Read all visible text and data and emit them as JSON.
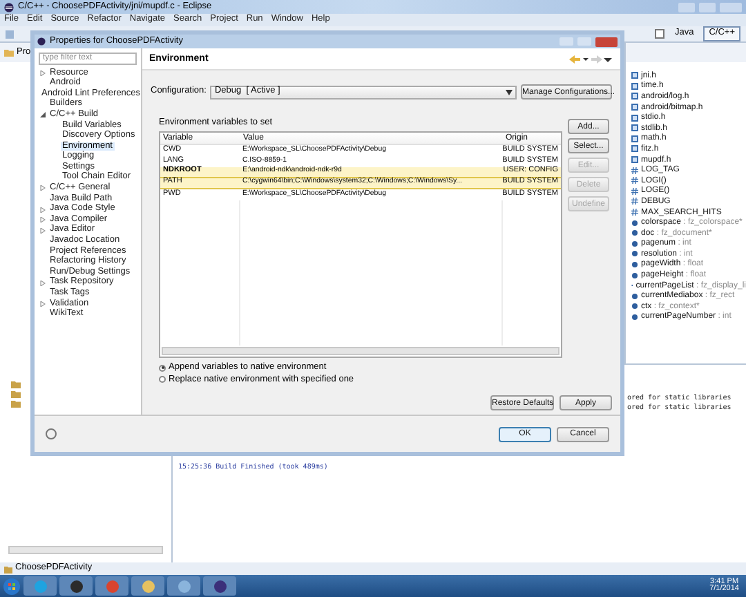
{
  "window": {
    "title": "C/C++ - ChoosePDFActivity/jni/mupdf.c - Eclipse",
    "menu": [
      "File",
      "Edit",
      "Source",
      "Refactor",
      "Navigate",
      "Search",
      "Project",
      "Run",
      "Window",
      "Help"
    ]
  },
  "toolbar": {
    "perspectives": [
      {
        "label": "Java",
        "selected": false
      },
      {
        "label": "C/C++",
        "selected": true
      }
    ]
  },
  "project_explorer": {
    "tab": "Pro"
  },
  "dialog": {
    "title": "Properties for ChoosePDFActivity",
    "filter": {
      "placeholder": "type filter text"
    },
    "tree": [
      {
        "label": "Resource",
        "expanded": false,
        "selected": false
      },
      {
        "label": "Android",
        "selected": false
      },
      {
        "label": "Android Lint Preferences",
        "selected": false
      },
      {
        "label": "Builders",
        "selected": false
      },
      {
        "label": "C/C++ Build",
        "expanded": true,
        "selected": false,
        "children": [
          {
            "label": "Build Variables",
            "selected": false
          },
          {
            "label": "Discovery Options",
            "selected": false
          },
          {
            "label": "Environment",
            "selected": true
          },
          {
            "label": "Logging",
            "selected": false
          },
          {
            "label": "Settings",
            "selected": false
          },
          {
            "label": "Tool Chain Editor",
            "selected": false
          }
        ]
      },
      {
        "label": "C/C++ General",
        "expanded": false,
        "selected": false
      },
      {
        "label": "Java Build Path",
        "selected": false
      },
      {
        "label": "Java Code Style",
        "expanded": false,
        "selected": false
      },
      {
        "label": "Java Compiler",
        "expanded": false,
        "selected": false
      },
      {
        "label": "Java Editor",
        "expanded": false,
        "selected": false
      },
      {
        "label": "Javadoc Location",
        "selected": false
      },
      {
        "label": "Project References",
        "selected": false
      },
      {
        "label": "Refactoring History",
        "selected": false
      },
      {
        "label": "Run/Debug Settings",
        "selected": false
      },
      {
        "label": "Task Repository",
        "expanded": false,
        "selected": false
      },
      {
        "label": "Task Tags",
        "selected": false
      },
      {
        "label": "Validation",
        "expanded": false,
        "selected": false
      },
      {
        "label": "WikiText",
        "selected": false
      }
    ],
    "page_title": "Environment",
    "configuration": {
      "label": "Configuration:",
      "value": "Debug  [ Active ]",
      "button": "Manage Configurations..."
    },
    "table_caption": "Environment variables to set",
    "columns": [
      "Variable",
      "Value",
      "Origin"
    ],
    "rows": [
      {
        "variable": "CWD",
        "value": "E:\\Workspace_SL\\ChoosePDFActivity\\Debug",
        "origin": "BUILD SYSTEM",
        "user_defined": false,
        "highlighted": false
      },
      {
        "variable": "LANG",
        "value": "C.ISO-8859-1",
        "origin": "BUILD SYSTEM",
        "user_defined": false,
        "highlighted": false
      },
      {
        "variable": "NDKROOT",
        "value": "E:\\android-ndk\\android-ndk-r9d",
        "origin": "USER: CONFIG",
        "user_defined": true,
        "highlighted": true
      },
      {
        "variable": "PATH",
        "value": "C:\\cygwin64\\bin;C:\\Windows\\system32;C:\\Windows;C:\\Windows\\Sy...",
        "origin": "BUILD SYSTEM",
        "user_defined": false,
        "highlighted": true
      },
      {
        "variable": "PWD",
        "value": "E:\\Workspace_SL\\ChoosePDFActivity\\Debug",
        "origin": "BUILD SYSTEM",
        "user_defined": false,
        "highlighted": false
      }
    ],
    "side_buttons": [
      {
        "label": "Add...",
        "disabled": false
      },
      {
        "label": "Select...",
        "disabled": false
      },
      {
        "label": "Edit...",
        "disabled": true
      },
      {
        "label": "Delete",
        "disabled": true
      },
      {
        "label": "Undefine",
        "disabled": true
      }
    ],
    "radios": [
      {
        "label": "Append variables to native environment",
        "selected": true
      },
      {
        "label": "Replace native environment with specified one",
        "selected": false
      }
    ],
    "page_buttons": [
      "Restore Defaults",
      "Apply"
    ],
    "buttons": [
      {
        "label": "OK",
        "default": true
      },
      {
        "label": "Cancel",
        "default": false
      }
    ]
  },
  "outline": {
    "items": [
      {
        "kind": "include",
        "label": "jni.h"
      },
      {
        "kind": "include",
        "label": "time.h"
      },
      {
        "kind": "include",
        "label": "android/log.h"
      },
      {
        "kind": "include",
        "label": "android/bitmap.h"
      },
      {
        "kind": "include",
        "label": "stdio.h"
      },
      {
        "kind": "include",
        "label": "stdlib.h"
      },
      {
        "kind": "include",
        "label": "math.h"
      },
      {
        "kind": "include",
        "label": "fitz.h"
      },
      {
        "kind": "include",
        "label": "mupdf.h"
      },
      {
        "kind": "macro",
        "label": "LOG_TAG"
      },
      {
        "kind": "macro",
        "label": "LOGI()"
      },
      {
        "kind": "macro",
        "label": "LOGE()"
      },
      {
        "kind": "macro",
        "label": "DEBUG"
      },
      {
        "kind": "macro",
        "label": "MAX_SEARCH_HITS"
      },
      {
        "kind": "field",
        "label": "colorspace",
        "type": " : fz_colorspace*"
      },
      {
        "kind": "field",
        "label": "doc",
        "type": " : fz_document*"
      },
      {
        "kind": "field",
        "label": "pagenum",
        "type": " : int"
      },
      {
        "kind": "field",
        "label": "resolution",
        "type": " : int"
      },
      {
        "kind": "field",
        "label": "pageWidth",
        "type": " : float"
      },
      {
        "kind": "field",
        "label": "pageHeight",
        "type": " : float"
      },
      {
        "kind": "field",
        "label": "currentPageList",
        "type": " : fz_display_li"
      },
      {
        "kind": "field",
        "label": "currentMediabox",
        "type": " : fz_rect"
      },
      {
        "kind": "field",
        "label": "ctx",
        "type": " : fz_context*"
      },
      {
        "kind": "field",
        "label": "currentPageNumber",
        "type": " : int"
      }
    ]
  },
  "console": {
    "lines": [
      {
        "text": "ored for static libraries",
        "kind": "clipped"
      },
      {
        "text": "ored for static libraries",
        "kind": "clipped"
      },
      {
        "text": "15:25:36 Build Finished (took 489ms)",
        "kind": "status"
      }
    ]
  },
  "status_bar": "ChoosePDFActivity",
  "taskbar": {
    "time": "3:41 PM",
    "date": "7/1/2014"
  }
}
